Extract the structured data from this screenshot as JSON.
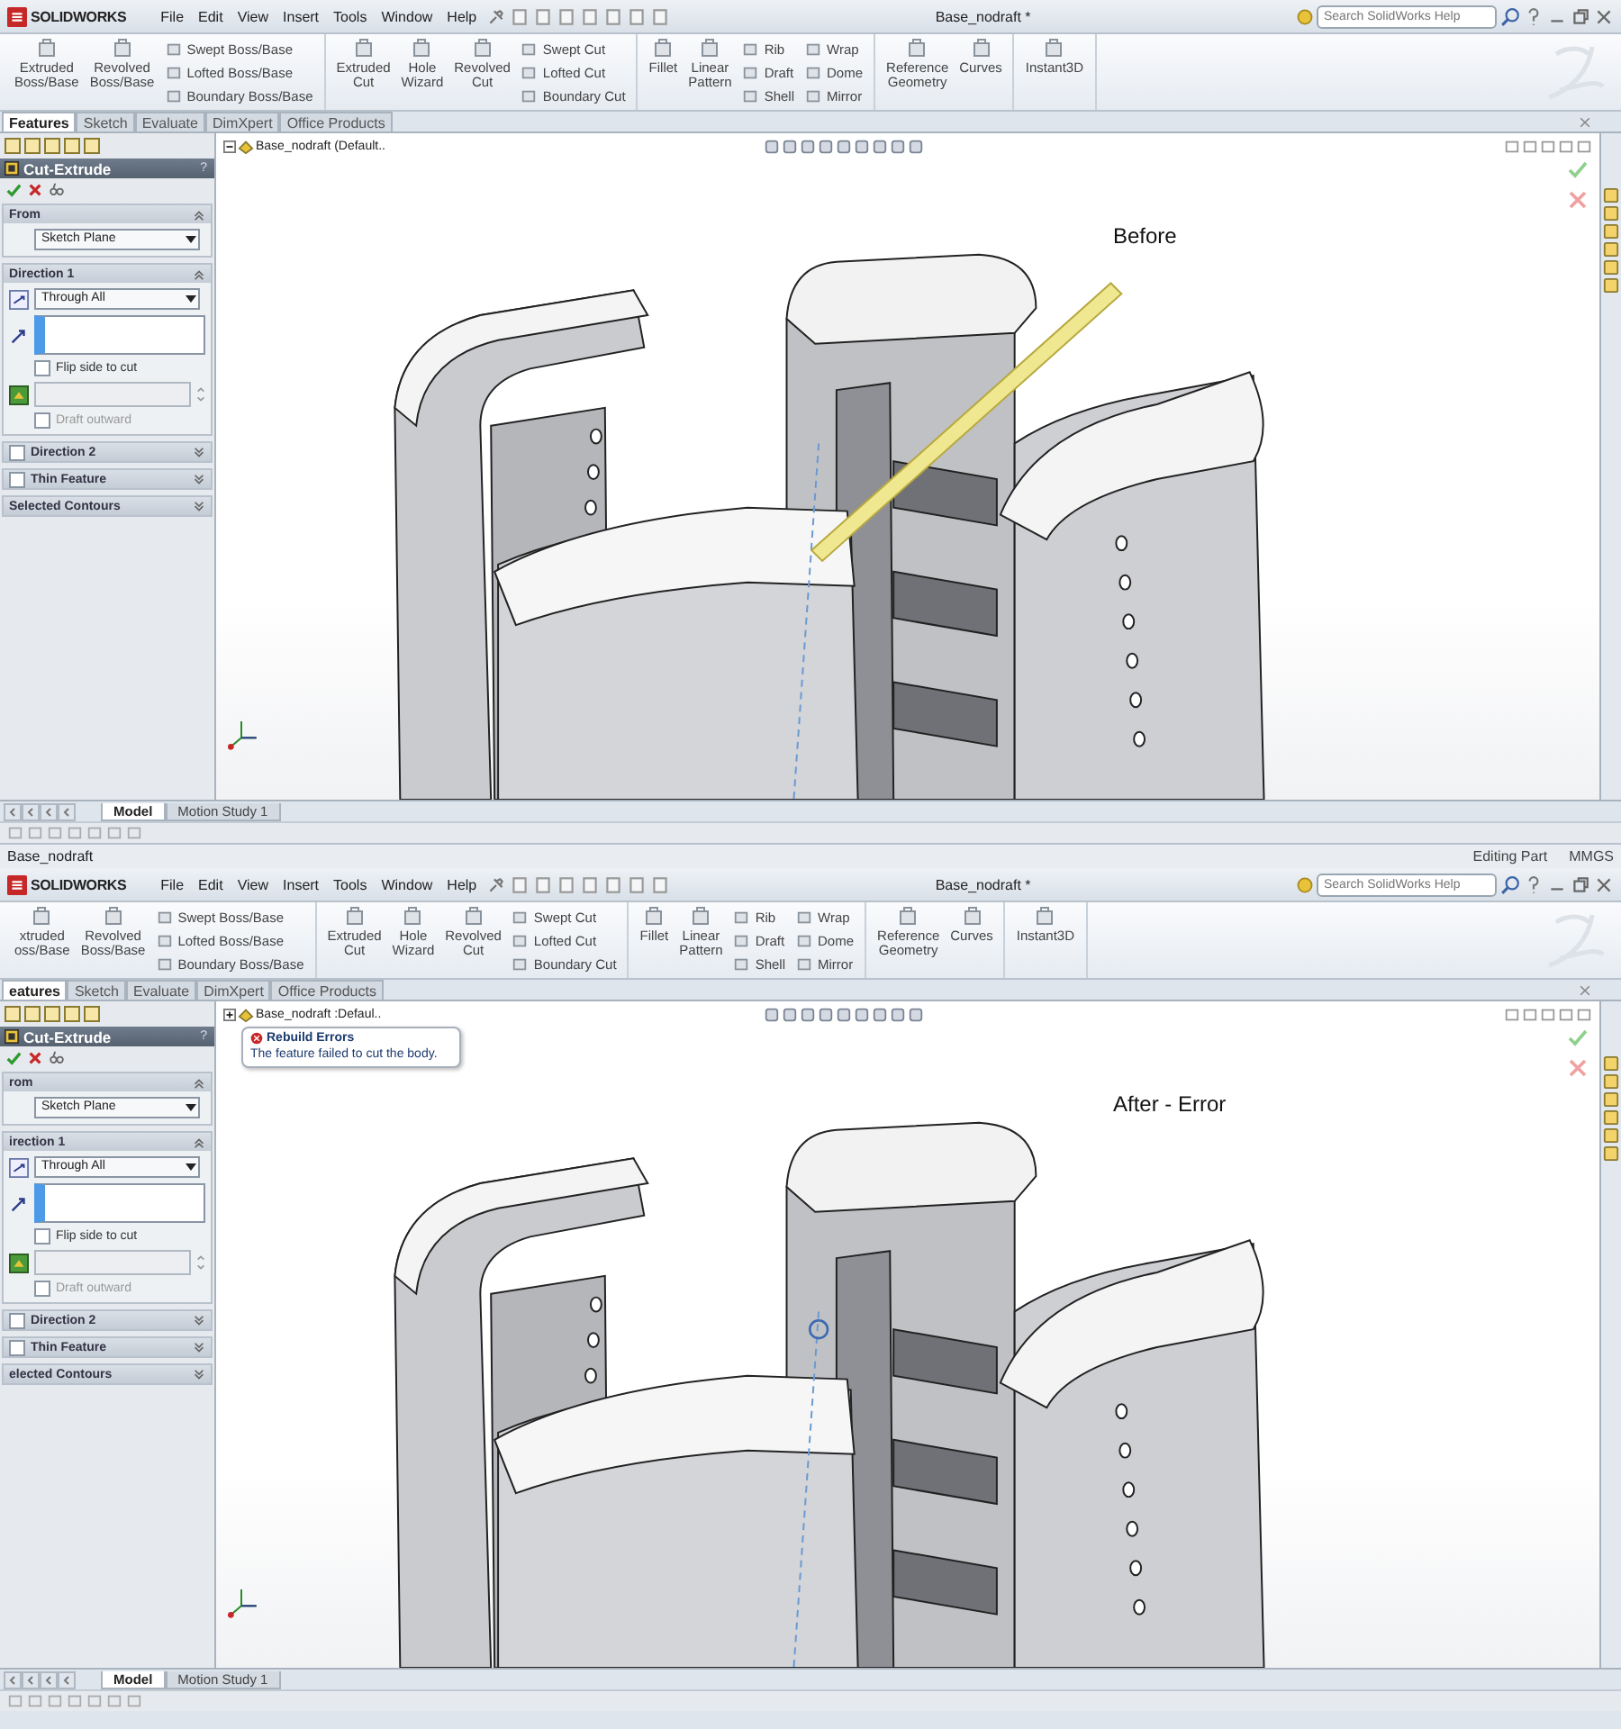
{
  "windows": [
    {
      "logo": "SOLIDWORKS",
      "menu": [
        "File",
        "Edit",
        "View",
        "Insert",
        "Tools",
        "Window",
        "Help"
      ],
      "document_title": "Base_nodraft *",
      "search": {
        "placeholder": "Search SolidWorks Help"
      },
      "ribbon": [
        {
          "columns": [
            {
              "kind": "large",
              "lines": [
                "Extruded",
                "Boss/Base"
              ]
            },
            {
              "kind": "large",
              "lines": [
                "Revolved",
                "Boss/Base"
              ]
            },
            {
              "kind": "stack",
              "items": [
                "Swept Boss/Base",
                "Lofted Boss/Base",
                "Boundary Boss/Base"
              ]
            }
          ]
        },
        {
          "columns": [
            {
              "kind": "large",
              "lines": [
                "Extruded",
                "Cut"
              ]
            },
            {
              "kind": "large",
              "lines": [
                "Hole",
                "Wizard"
              ]
            },
            {
              "kind": "large",
              "lines": [
                "Revolved",
                "Cut"
              ]
            },
            {
              "kind": "stack",
              "items": [
                "Swept Cut",
                "Lofted Cut",
                "Boundary Cut"
              ]
            }
          ]
        },
        {
          "columns": [
            {
              "kind": "large",
              "lines": [
                "Fillet"
              ]
            },
            {
              "kind": "large",
              "lines": [
                "Linear",
                "Pattern"
              ]
            },
            {
              "kind": "stack",
              "items": [
                "Rib",
                "Draft",
                "Shell"
              ]
            },
            {
              "kind": "stack",
              "items": [
                "Wrap",
                "Dome",
                "Mirror"
              ]
            }
          ]
        },
        {
          "columns": [
            {
              "kind": "large",
              "lines": [
                "Reference",
                "Geometry"
              ]
            },
            {
              "kind": "large",
              "lines": [
                "Curves"
              ]
            }
          ]
        },
        {
          "columns": [
            {
              "kind": "large",
              "lines": [
                "Instant3D"
              ]
            }
          ]
        }
      ],
      "tabs": [
        {
          "label": "Features",
          "selected": true
        },
        {
          "label": "Sketch",
          "selected": false
        },
        {
          "label": "Evaluate",
          "selected": false
        },
        {
          "label": "DimXpert",
          "selected": false
        },
        {
          "label": "Office Products",
          "selected": false
        }
      ],
      "panel": {
        "title": "Cut-Extrude",
        "help": "?",
        "sections": [
          {
            "kind": "dropdown",
            "title": "From",
            "expanded": true,
            "value": "Sketch Plane"
          },
          {
            "kind": "direction",
            "title": "Direction 1",
            "expanded": true,
            "value": "Through All",
            "flip": {
              "label": "Flip side to cut",
              "checked": false
            },
            "draft": {
              "label": "Draft outward",
              "checked": false
            }
          },
          {
            "kind": "optional",
            "title": "Direction 2",
            "expanded": false,
            "checked": false
          },
          {
            "kind": "optional",
            "title": "Thin Feature",
            "expanded": false,
            "checked": false
          },
          {
            "kind": "plain",
            "title": "Selected Contours",
            "expanded": false
          }
        ]
      },
      "viewport": {
        "tree_label": "Base_nodraft (Default..",
        "tree_expanded": true,
        "label": "Before",
        "preview": true
      },
      "bottom_tabs": [
        {
          "label": "Model",
          "selected": true
        },
        {
          "label": "Motion Study 1",
          "selected": false
        }
      ]
    },
    {
      "caption": "Base_nodraft",
      "status": [
        "Editing Part",
        "MMGS"
      ],
      "logo": "SOLIDWORKS",
      "menu": [
        "File",
        "Edit",
        "View",
        "Insert",
        "Tools",
        "Window",
        "Help"
      ],
      "document_title": "Base_nodraft *",
      "search": {
        "placeholder": "Search SolidWorks Help"
      },
      "ribbon": [
        {
          "columns": [
            {
              "kind": "large",
              "lines": [
                "xtruded",
                "oss/Base"
              ]
            },
            {
              "kind": "large",
              "lines": [
                "Revolved",
                "Boss/Base"
              ]
            },
            {
              "kind": "stack",
              "items": [
                "Swept Boss/Base",
                "Lofted Boss/Base",
                "Boundary Boss/Base"
              ]
            }
          ]
        },
        {
          "columns": [
            {
              "kind": "large",
              "lines": [
                "Extruded",
                "Cut"
              ]
            },
            {
              "kind": "large",
              "lines": [
                "Hole",
                "Wizard"
              ]
            },
            {
              "kind": "large",
              "lines": [
                "Revolved",
                "Cut"
              ]
            },
            {
              "kind": "stack",
              "items": [
                "Swept Cut",
                "Lofted Cut",
                "Boundary Cut"
              ]
            }
          ]
        },
        {
          "columns": [
            {
              "kind": "large",
              "lines": [
                "Fillet"
              ]
            },
            {
              "kind": "large",
              "lines": [
                "Linear",
                "Pattern"
              ]
            },
            {
              "kind": "stack",
              "items": [
                "Rib",
                "Draft",
                "Shell"
              ]
            },
            {
              "kind": "stack",
              "items": [
                "Wrap",
                "Dome",
                "Mirror"
              ]
            }
          ]
        },
        {
          "columns": [
            {
              "kind": "large",
              "lines": [
                "Reference",
                "Geometry"
              ]
            },
            {
              "kind": "large",
              "lines": [
                "Curves"
              ]
            }
          ]
        },
        {
          "columns": [
            {
              "kind": "large",
              "lines": [
                "Instant3D"
              ]
            }
          ]
        }
      ],
      "tabs": [
        {
          "label": "eatures",
          "selected": true
        },
        {
          "label": "Sketch",
          "selected": false
        },
        {
          "label": "Evaluate",
          "selected": false
        },
        {
          "label": "DimXpert",
          "selected": false
        },
        {
          "label": "Office Products",
          "selected": false
        }
      ],
      "panel": {
        "title": "Cut-Extrude",
        "help": "?",
        "sections": [
          {
            "kind": "dropdown",
            "title": "rom",
            "expanded": true,
            "value": "Sketch Plane"
          },
          {
            "kind": "direction",
            "title": "irection 1",
            "expanded": true,
            "value": "Through All",
            "flip": {
              "label": "Flip side to cut",
              "checked": false
            },
            "draft": {
              "label": "Draft outward",
              "checked": false
            }
          },
          {
            "kind": "optional",
            "title": "Direction 2",
            "expanded": false,
            "checked": false
          },
          {
            "kind": "optional",
            "title": "Thin Feature",
            "expanded": false,
            "checked": false
          },
          {
            "kind": "plain",
            "title": "elected Contours",
            "expanded": false
          }
        ]
      },
      "viewport": {
        "tree_label": "Base_nodraft :Defaul..",
        "tree_expanded": false,
        "label": "After - Error",
        "preview": false,
        "error": {
          "title": "Rebuild Errors",
          "message": "The feature failed to cut the body."
        }
      },
      "bottom_tabs": [
        {
          "label": "Model",
          "selected": true
        },
        {
          "label": "Motion Study 1",
          "selected": false
        }
      ]
    }
  ]
}
